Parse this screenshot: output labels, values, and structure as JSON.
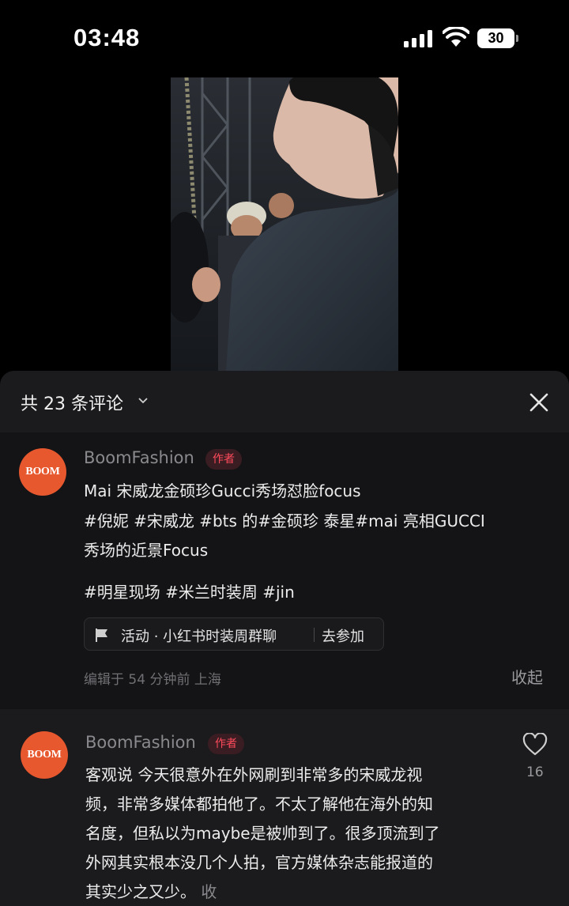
{
  "status_bar": {
    "time": "03:48",
    "battery": "30"
  },
  "sheet": {
    "comment_count": "共 23 条评论"
  },
  "post": {
    "avatar_text": "BOOM",
    "author": "BoomFashion",
    "badge": "作者",
    "lines": [
      "Mai 宋威龙金硕珍Gucci秀场怼脸focus",
      "#倪妮 #宋威龙 #bts 的#金硕珍 泰星#mai 亮相GUCCI",
      "秀场的近景Focus",
      "#明星现场 #米兰时装周 #jin"
    ],
    "activity_label": "活动 · 小红书时装周群聊",
    "activity_action": "去参加",
    "meta": "编辑于  54 分钟前  上海",
    "collapse": "收起"
  },
  "comment": {
    "avatar_text": "BOOM",
    "author": "BoomFashion",
    "badge": "作者",
    "lines": [
      "客观说 今天很意外在外网刷到非常多的宋威龙视",
      "频，非常多媒体都拍他了。不太了解他在海外的知",
      "名度，但私以为maybe是被帅到了。很多顶流到了",
      "外网其实根本没几个人拍，官方媒体杂志能报道的",
      "其实少之又少。"
    ],
    "more": "收",
    "likes": "16"
  },
  "icons": [
    "signal-icon",
    "wifi-icon",
    "battery-icon",
    "chevron-down-icon",
    "close-icon",
    "flag-icon",
    "heart-icon"
  ]
}
